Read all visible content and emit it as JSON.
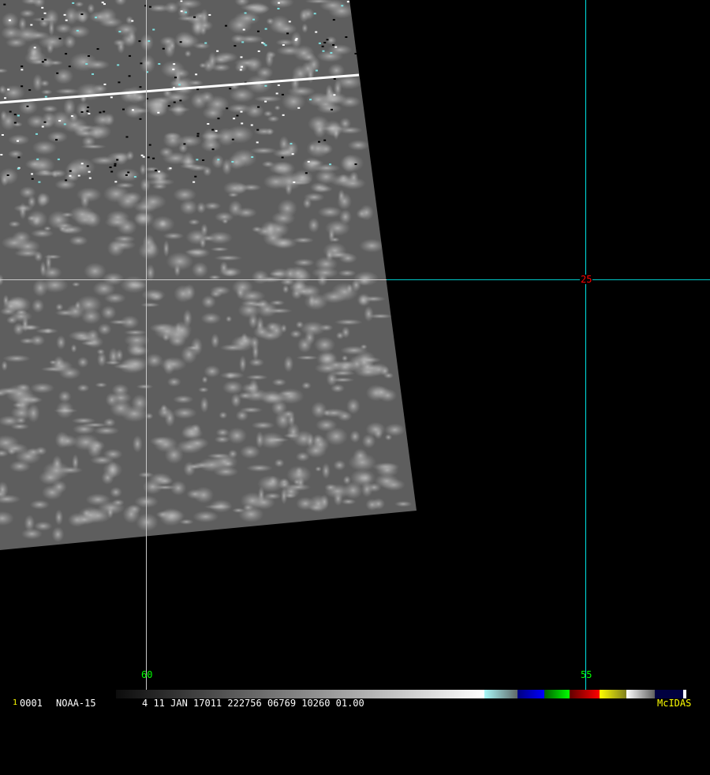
{
  "image": {
    "satellite_label": "NOAA-15",
    "frame_number": "1",
    "frame_id": "0001",
    "info": "4 11 JAN 17011 222756 06769 10260 01.00",
    "software": "McIDAS"
  },
  "grid": {
    "longitude_labels": [
      "60",
      "55"
    ],
    "latitude_labels": [
      "25"
    ]
  },
  "colors": {
    "grid_line": "#c8c8c8",
    "lon_label": "#00ff00",
    "lat_label": "#ff0000",
    "cyan_line": "#00e5e5",
    "software_label": "#ffff00"
  }
}
